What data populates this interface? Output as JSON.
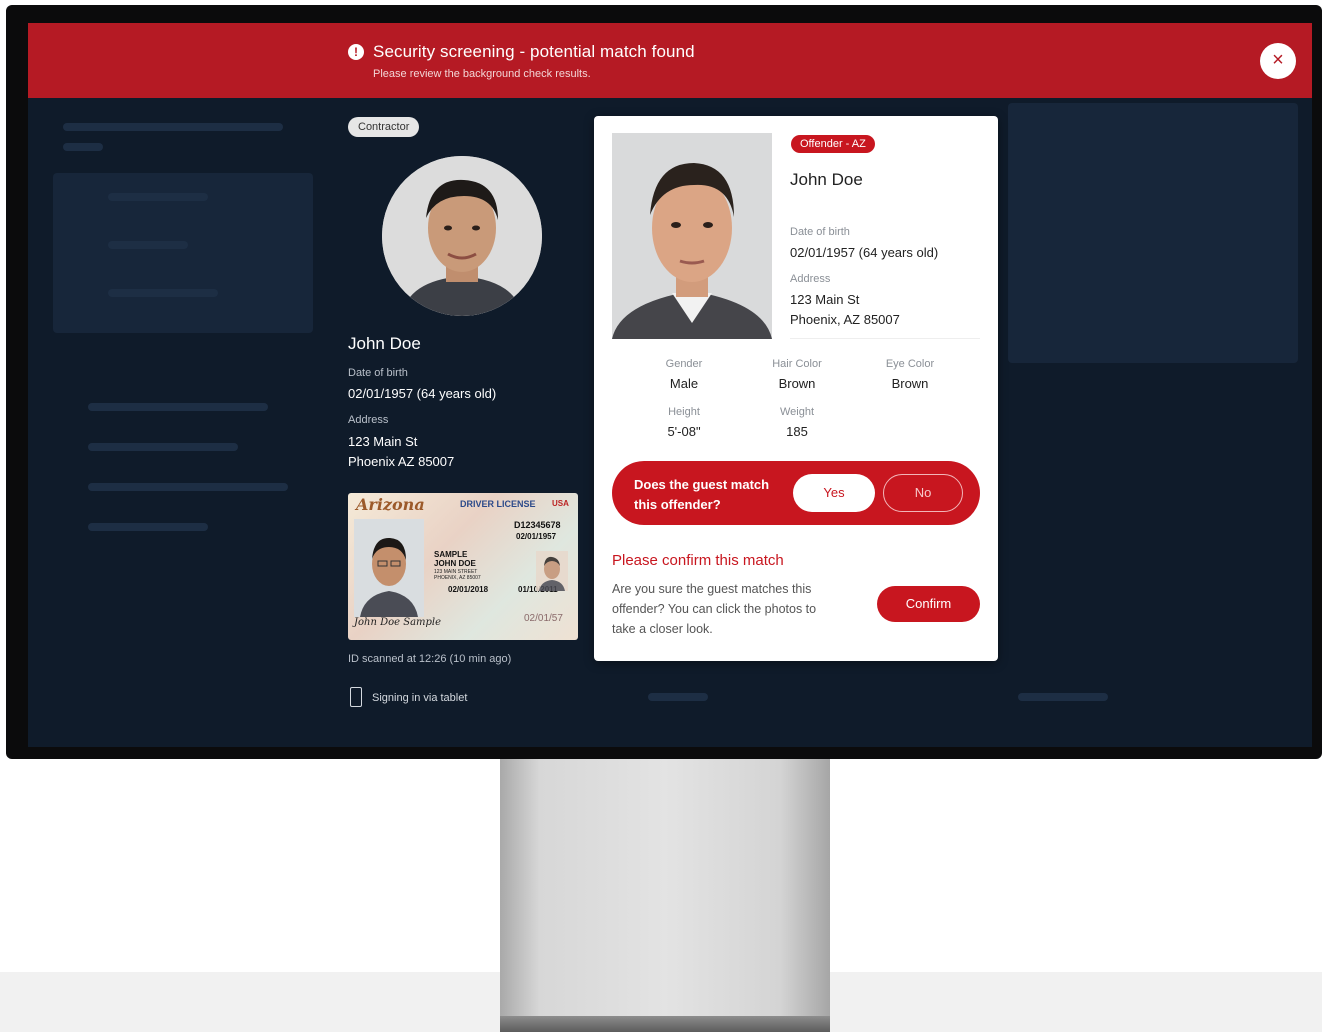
{
  "alert": {
    "icon": "exclamation-circle-icon",
    "title": "Security screening - potential match found",
    "subtitle": "Please review the background check results.",
    "close_icon": "close-icon",
    "close_label": "×"
  },
  "guest": {
    "badge": "Contractor",
    "name": "John Doe",
    "dob_label": "Date of birth",
    "dob_value": "02/01/1957 (64 years old)",
    "address_label": "Address",
    "address_line1": "123 Main St",
    "address_line2": "Phoenix AZ 85007",
    "scan_note": "ID scanned at 12:26 (10 min ago)",
    "signin_note": "Signing in via tablet",
    "signin_icon": "tablet-icon"
  },
  "id_card": {
    "state": "Arizona",
    "title": "DRIVER LICENSE",
    "country": "USA",
    "dl_number": "D12345678",
    "dob": "02/01/1957",
    "name1": "SAMPLE",
    "name2": "JOHN DOE",
    "street": "123 MAIN STREET",
    "city": "PHOENIX, AZ 85007",
    "exp": "02/01/2018",
    "iss": "01/10/2011",
    "sig": "John Doe Sample",
    "stamp": "02/01/57"
  },
  "offender": {
    "badge": "Offender - AZ",
    "name": "John Doe",
    "dob_label": "Date of birth",
    "dob_value": "02/01/1957  (64 years old)",
    "address_label": "Address",
    "address_line1": "123 Main St",
    "address_line2": "Phoenix, AZ 85007",
    "attributes": [
      {
        "label": "Gender",
        "value": "Male"
      },
      {
        "label": "Hair Color",
        "value": "Brown"
      },
      {
        "label": "Eye Color",
        "value": "Brown"
      },
      {
        "label": "Height",
        "value": "5'-08\""
      },
      {
        "label": "Weight",
        "value": "185"
      }
    ]
  },
  "match": {
    "question": "Does the guest match this offender?",
    "yes_label": "Yes",
    "no_label": "No",
    "confirm_title": "Please confirm this match",
    "confirm_text": "Are you sure the guest matches this offender? You can click the photos to take a closer look.",
    "confirm_button": "Confirm"
  },
  "colors": {
    "alert_red": "#b51a24",
    "accent_red": "#c8161f",
    "screen_bg": "#0f1b2a"
  }
}
